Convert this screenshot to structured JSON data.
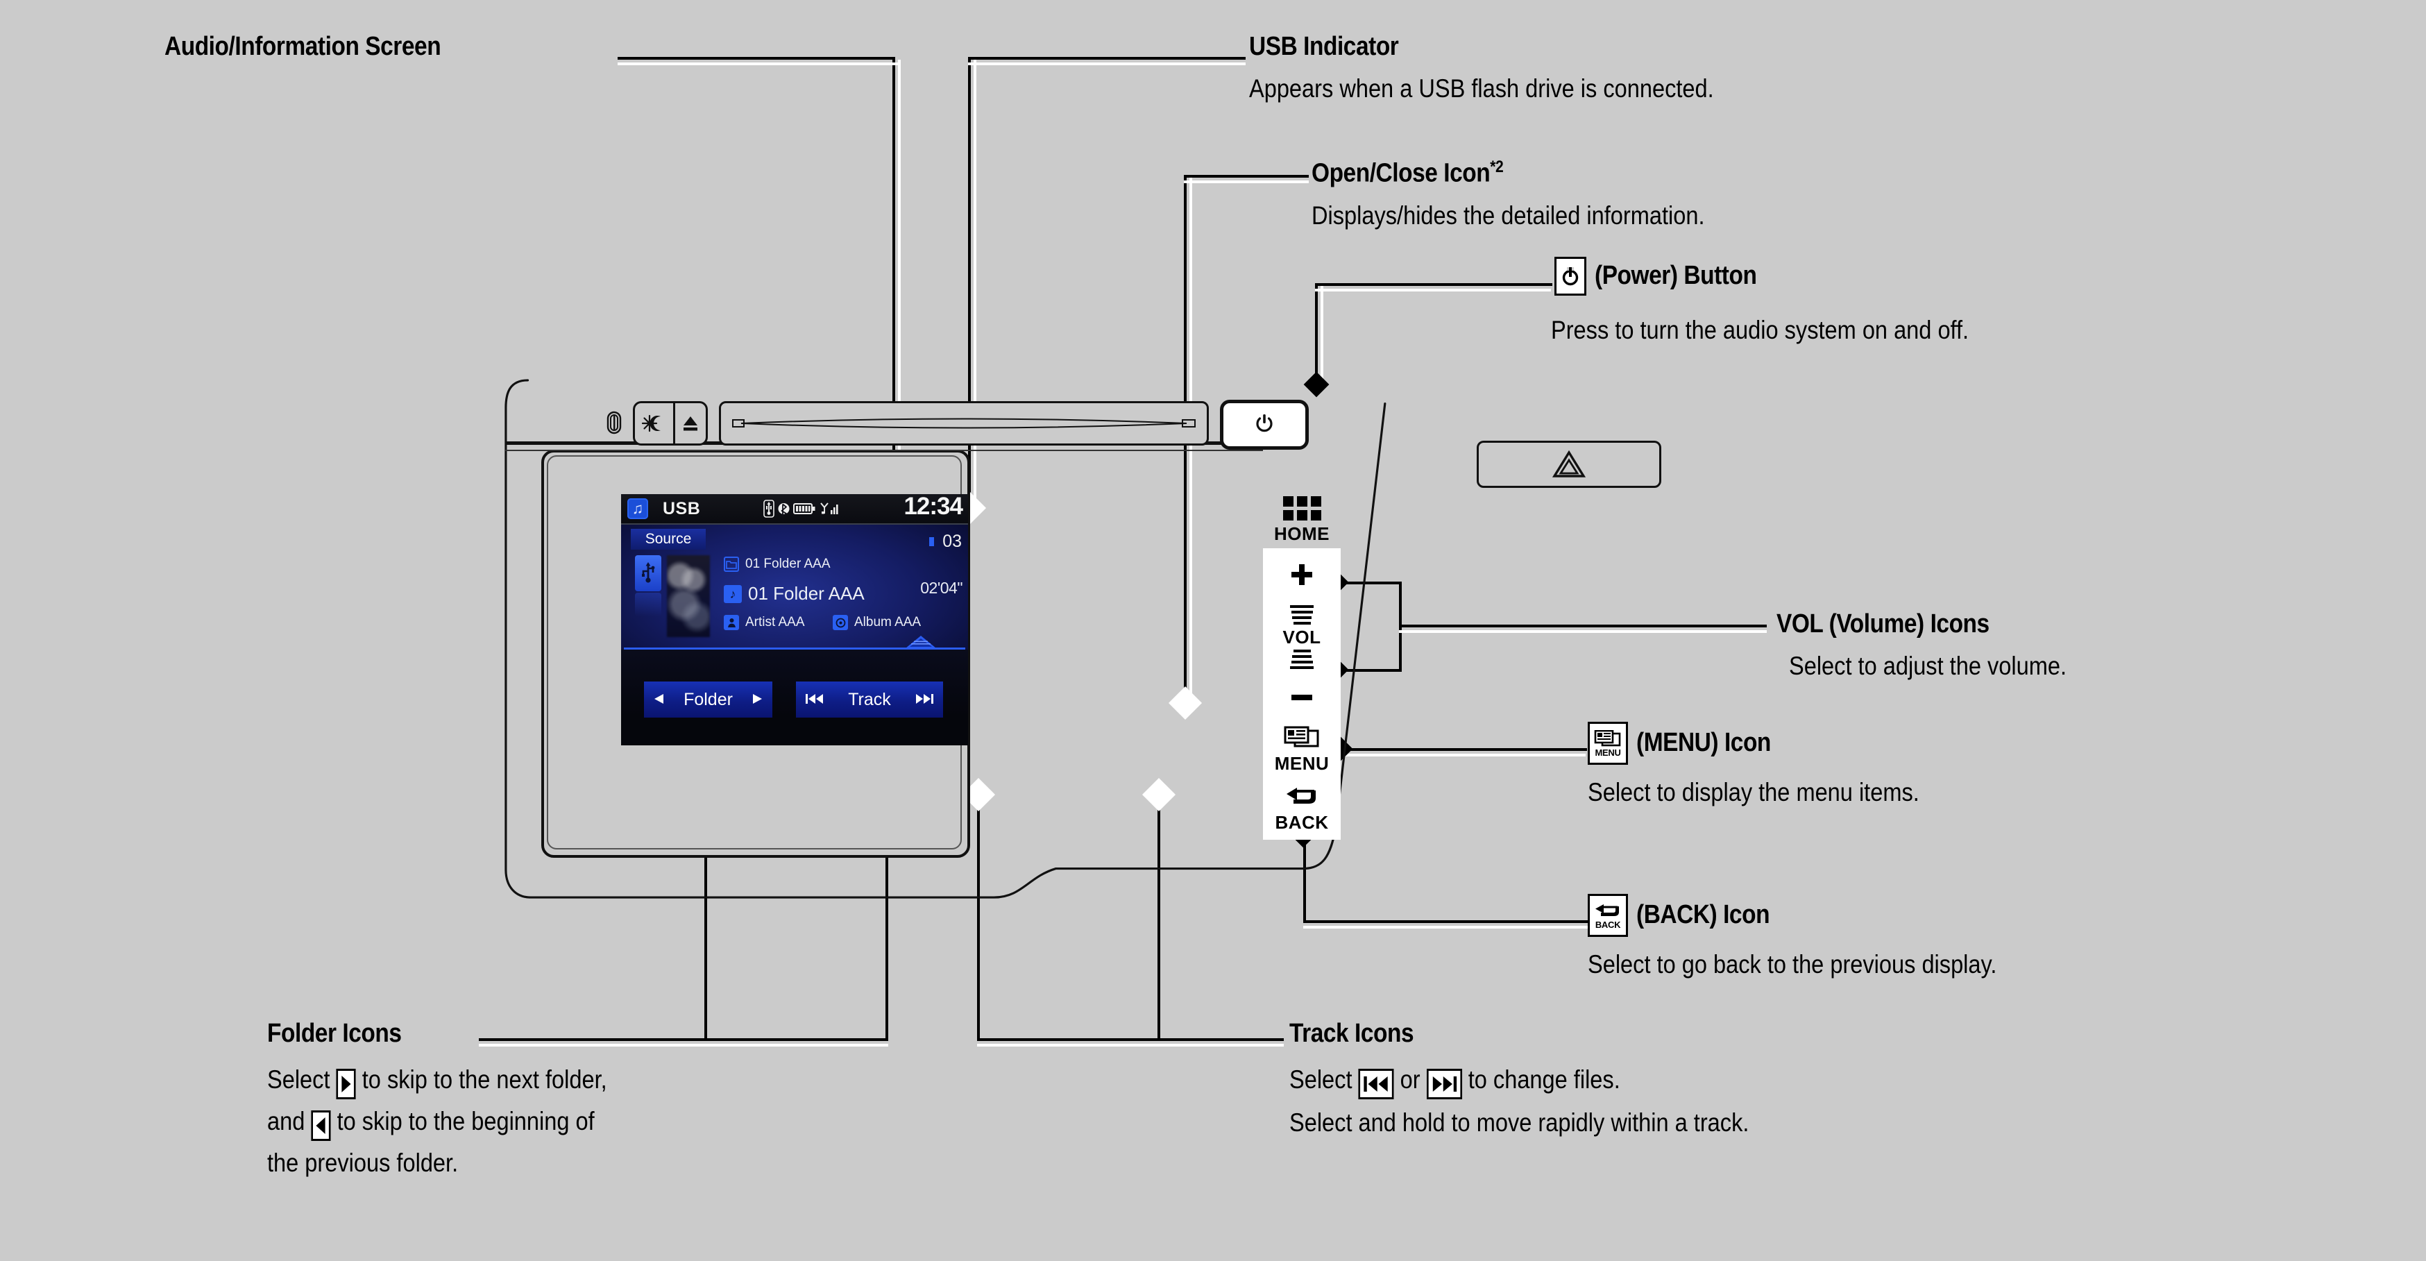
{
  "page": {
    "background_color": "#cbcbcb",
    "diagram_type": "automotive-audio-head-unit-callout"
  },
  "callouts": [
    {
      "id": "audio-information-screen",
      "title": "Audio/Information Screen",
      "body": []
    },
    {
      "id": "usb-indicator",
      "title": "USB Indicator",
      "body": [
        "Appears when a USB flash drive is connected."
      ]
    },
    {
      "id": "open-close-icon",
      "title": "Open/Close Icon",
      "title_superscript": "*2",
      "body": [
        "Displays/hides the detailed information."
      ]
    },
    {
      "id": "power-button",
      "title": "(Power) Button",
      "icon": "power-icon",
      "body": [
        "Press to turn the audio system on and off."
      ]
    },
    {
      "id": "vol-icons",
      "title": "VOL (Volume) Icons",
      "body": [
        "Select to adjust the volume."
      ]
    },
    {
      "id": "menu-icon",
      "title": "(MENU) Icon",
      "icon": "menu-icon",
      "body": [
        "Select to display the menu items."
      ]
    },
    {
      "id": "back-icon",
      "title": "(BACK) Icon",
      "icon": "back-icon",
      "body": [
        "Select to go back to the previous display."
      ]
    },
    {
      "id": "folder-icons",
      "title": "Folder Icons",
      "body": [
        "Select ▶ to skip to the next folder,",
        "and ◀ to skip to the beginning of",
        "the previous folder."
      ],
      "body_parts": {
        "line1_pre": "Select",
        "line1_post": "to skip to the next folder,",
        "line2_pre": "and",
        "line2_post": "to skip to the beginning of",
        "line3": "the previous folder."
      }
    },
    {
      "id": "track-icons",
      "title": "Track Icons",
      "body_parts": {
        "line1_pre": "Select",
        "line1_mid": "or",
        "line1_post": "to change files.",
        "line2": "Select and hold to move rapidly within a track."
      }
    }
  ],
  "head_unit": {
    "top_strip": {
      "screw_left_icon": "screw-icon",
      "screw_right_icon": "screw-icon",
      "display_button_icon": "brightness-day-night-icon",
      "eject_button_icon": "eject-icon",
      "disc_slot_icon": "disc-slot",
      "power_button_icon": "power-icon"
    },
    "hazard_button_icon": "hazard-triangle-icon",
    "hard_keys": [
      {
        "id": "home",
        "label": "HOME",
        "icon": "grid-icon"
      },
      {
        "id": "vol-up",
        "label": "+",
        "icon": "plus-icon"
      },
      {
        "id": "vol",
        "label": "VOL",
        "icon": "vol-bars-icon"
      },
      {
        "id": "vol-down",
        "label": "−",
        "icon": "minus-icon"
      },
      {
        "id": "menu",
        "label": "MENU",
        "icon": "menu-icon"
      },
      {
        "id": "back",
        "label": "BACK",
        "icon": "back-arrow-icon"
      }
    ]
  },
  "screen": {
    "status_bar": {
      "source_icon": "music-note-icon",
      "source_label": "USB",
      "indicator_icons": [
        "usb-icon",
        "bluetooth-icon",
        "battery-icon",
        "signal-bars-icon"
      ],
      "clock": "12:34"
    },
    "main": {
      "source_tab_label": "Source",
      "source_chip_icon": "usb-icon",
      "album_art": "blurred-album-art",
      "rows": [
        {
          "icon": "folder-icon",
          "text": "01 Folder AAA",
          "emphasis": "normal"
        },
        {
          "icon": "music-note-icon",
          "text": "01 Folder AAA",
          "emphasis": "large"
        },
        {
          "icon": "artist-icon",
          "text": "Artist AAA",
          "emphasis": "normal"
        },
        {
          "icon": "album-icon",
          "text": "Album AAA",
          "emphasis": "normal"
        }
      ],
      "track_number": "03",
      "track_time": "02'04\"",
      "open_close_handle": "open-close-icon"
    },
    "bottom_controls": [
      {
        "id": "folder",
        "label": "Folder",
        "left_icon": "prev-triangle-icon",
        "right_icon": "next-triangle-icon"
      },
      {
        "id": "track",
        "label": "Track",
        "left_icon": "skip-back-icon",
        "right_icon": "skip-forward-icon"
      }
    ]
  },
  "colors": {
    "page_bg": "#cbcbcb",
    "lcd_bg": "#050508",
    "lcd_blue": "#1b40c8",
    "accent_blue": "#2a60f2",
    "button_blue": "#0e1d86",
    "text_white": "#f2f2f2",
    "stroke": "#111111"
  }
}
